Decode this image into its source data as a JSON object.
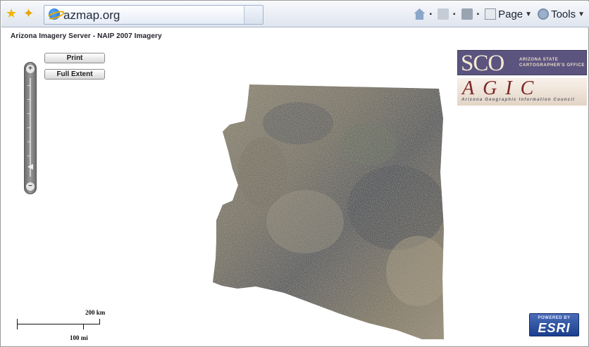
{
  "browser": {
    "tab_title": "azmap.org",
    "toolbar": {
      "page_label": "Page",
      "tools_label": "Tools"
    }
  },
  "page": {
    "title": "Arizona Imagery Server - NAIP 2007 Imagery"
  },
  "map": {
    "buttons": {
      "print": "Print",
      "full_extent": "Full Extent"
    },
    "zoom": {
      "in_symbol": "+",
      "out_symbol": "−",
      "level_fraction": 0.9
    },
    "logos": {
      "sco_letters": "SCO",
      "sco_subtitle": "ARIZONA STATE\nCARTOGRAPHER'S OFFICE",
      "agic_letters": "AGIC",
      "agic_subtitle": "Arizona Geographic Information Council",
      "esri_top": "POWERED BY",
      "esri_name": "ESRI"
    },
    "scale_bar": {
      "km_label": "200 km",
      "mi_label": "100 mi"
    }
  },
  "colors": {
    "browser_bar": "#dfe5ef",
    "sco_purple": "#5b547f",
    "agic_red": "#7b2727",
    "esri_blue": "#1b3f8f"
  }
}
